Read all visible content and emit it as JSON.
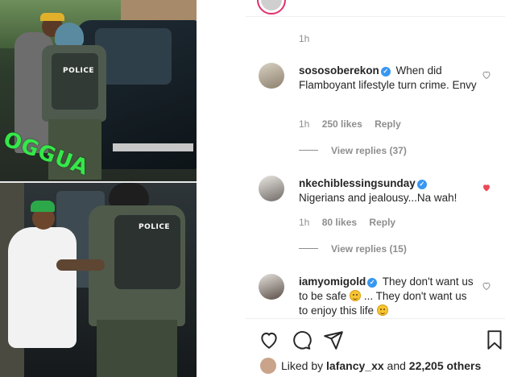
{
  "post": {
    "timestamp": "1h",
    "watermark": "OGGUA",
    "photo_top_vest_label": "POLICE",
    "photo_bottom_vest_label": "POLICE"
  },
  "comments": [
    {
      "username": "sososoberekon",
      "text": "When did Flamboyant lifestyle turn crime. Envy",
      "time": "1h",
      "likes": "250 likes",
      "reply_label": "Reply",
      "view_replies": "View replies (37)",
      "liked": false
    },
    {
      "username": "nkechiblessingsunday",
      "text": "Nigerians and jealousy...Na wah!",
      "time": "1h",
      "likes": "80 likes",
      "reply_label": "Reply",
      "view_replies": "View replies (15)",
      "liked": true
    },
    {
      "username": "iamyomigold",
      "text_part1": "They don't want us to be safe",
      "text_part2": " ... They don't want us to enjoy this life",
      "liked": false
    }
  ],
  "likes": {
    "prefix": "Liked by",
    "user": "lafancy_xx",
    "middle": "and",
    "count": "22,205 others"
  },
  "colors": {
    "heart_liked": "#ed4956",
    "verified": "#3897f0",
    "meta": "#8e8e8e",
    "watermark": "#35e84a"
  },
  "icons": [
    "heart-icon",
    "comment-icon",
    "share-icon",
    "bookmark-icon",
    "verified-badge-icon"
  ]
}
